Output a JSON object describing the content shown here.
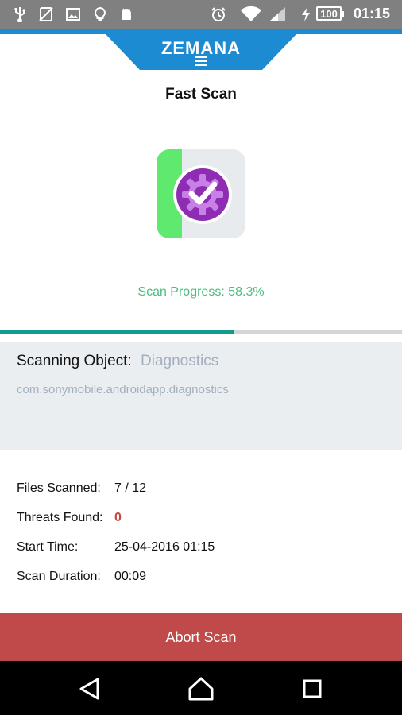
{
  "status_bar": {
    "time": "01:15",
    "battery": "100",
    "left_icons": [
      "usb-icon",
      "no-sim-icon",
      "image-icon",
      "lightbulb-icon",
      "android-icon"
    ],
    "right_icons": [
      "alarm-icon",
      "wifi-icon",
      "signal-icon",
      "charging-icon",
      "battery-icon"
    ]
  },
  "header": {
    "logo": "ZEMANA",
    "menu_icon": "hamburger-menu-icon"
  },
  "page": {
    "title": "Fast Scan"
  },
  "scan": {
    "progress_text": "Scan Progress: 58.3%",
    "progress_fraction": 0.583,
    "object_label": "Scanning Object:",
    "object_value": "Diagnostics",
    "object_package": "com.sonymobile.androidapp.diagnostics"
  },
  "stats": {
    "files_label": "Files Scanned:",
    "files_value": "7 / 12",
    "threats_label": "Threats Found:",
    "threats_value": "0",
    "start_label": "Start Time:",
    "start_value": "25-04-2016 01:15",
    "duration_label": "Scan Duration:",
    "duration_value": "00:09"
  },
  "actions": {
    "abort_label": "Abort Scan"
  },
  "colors": {
    "brand_blue": "#1c8bd1",
    "progress_green": "#4cbd7f",
    "progress_bar": "#119b8e",
    "threat_red": "#c8473b",
    "abort_red": "#c04a4a"
  }
}
